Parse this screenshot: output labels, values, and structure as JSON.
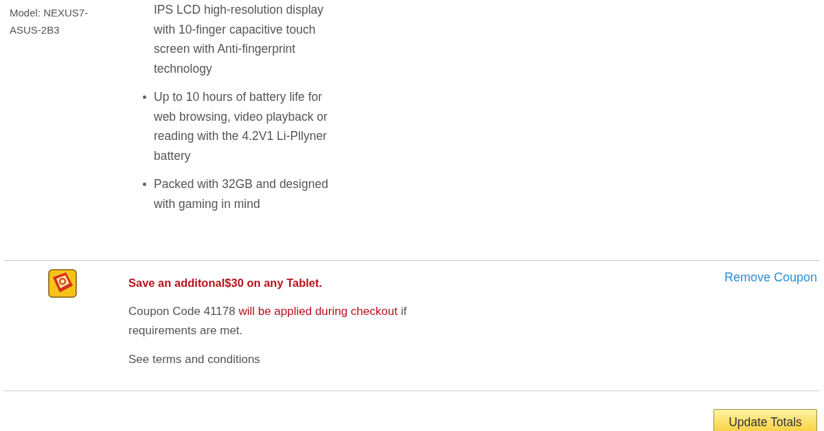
{
  "product": {
    "model": "Model: NEXUS7-ASUS-2B3",
    "features": [
      {
        "kind": "continuation",
        "text": "IPS LCD high-resolution display with 10-finger capacitive touch screen with Anti-fingerprint technology"
      },
      {
        "kind": "bullet",
        "text": "Up to 10 hours of battery life for web browsing, video playback or reading with the 4.2V1 Li-Pllyner battery"
      },
      {
        "kind": "bullet",
        "text": "Packed with 32GB and designed with gaming in mind"
      }
    ]
  },
  "coupon": {
    "headline": "Save an additonal$30 on any Tablet.",
    "details": [
      {
        "kind": "plain",
        "text": "Coupon Code 41178 "
      },
      {
        "kind": "highlight",
        "text": "will be applied during checkout"
      },
      {
        "kind": "plain",
        "text": " if requirements are met."
      }
    ],
    "terms": "See terms and conditions",
    "remove_link": "Remove Coupon"
  },
  "actions": {
    "update_button": "Update Totals"
  }
}
